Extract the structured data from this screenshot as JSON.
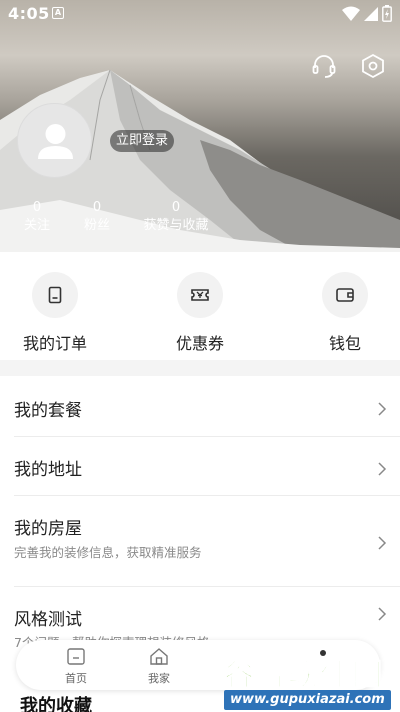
{
  "status_bar": {
    "time": "4:05",
    "notification_letter": "A"
  },
  "header": {
    "icons": [
      "headset-icon",
      "settings-icon"
    ]
  },
  "profile": {
    "login_label": "立即登录",
    "stats": [
      {
        "value": "0",
        "label": "关注"
      },
      {
        "value": "0",
        "label": "粉丝"
      },
      {
        "value": "0",
        "label": "获赞与收藏"
      }
    ]
  },
  "quick_actions": [
    {
      "label": "我的订单",
      "icon": "order-icon"
    },
    {
      "label": "优惠券",
      "icon": "coupon-icon"
    },
    {
      "label": "钱包",
      "icon": "wallet-icon"
    }
  ],
  "menu": [
    {
      "title": "我的套餐",
      "subtitle": ""
    },
    {
      "title": "我的地址",
      "subtitle": ""
    },
    {
      "title": "我的房屋",
      "subtitle": "完善我的装修信息，获取精准服务"
    },
    {
      "title": "风格测试",
      "subtitle": "7个问题，帮助你探索理想装修风格"
    }
  ],
  "bottom_nav": [
    {
      "label": "首页",
      "icon": "home-icon"
    },
    {
      "label": "我家",
      "icon": "house-icon"
    },
    {
      "label": "",
      "icon": ""
    },
    {
      "label": "",
      "icon": ""
    }
  ],
  "favorites_title": "我的收藏",
  "watermark": {
    "main": "谷普软件园",
    "sub": "www.gupuxiazai.com"
  },
  "colors": {
    "accent_green": "#7fc241",
    "watermark_blue": "#2e73b8"
  }
}
